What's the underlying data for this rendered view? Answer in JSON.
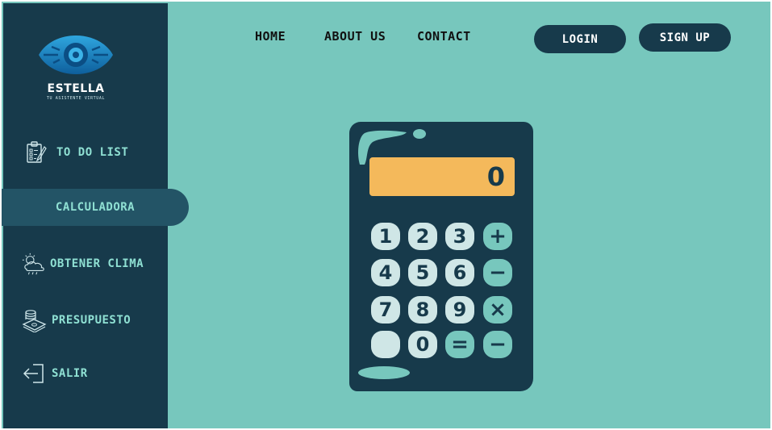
{
  "brand": {
    "name": "ESTELLA",
    "tagline": "TU ASISTENTE VIRTUAL"
  },
  "sidebar": {
    "items": [
      {
        "label": "TO DO LIST",
        "icon": "clipboard-checklist-icon"
      },
      {
        "label": "CALCULADORA",
        "icon": ""
      },
      {
        "label": "OBTENER CLIMA",
        "icon": "weather-cloud-icon"
      },
      {
        "label": "PRESUPUESTO",
        "icon": "money-stack-icon"
      },
      {
        "label": "SALIR",
        "icon": "logout-arrow-icon"
      }
    ],
    "active_index": 1
  },
  "topnav": {
    "links": [
      "HOME",
      "ABOUT US",
      "CONTACT"
    ],
    "login_label": "LOGIN",
    "signup_label": "SIGN UP"
  },
  "calculator": {
    "display_value": "0",
    "keys": [
      [
        "1",
        "2",
        "3",
        "+"
      ],
      [
        "4",
        "5",
        "6",
        "−"
      ],
      [
        "7",
        "8",
        "9",
        "×"
      ],
      [
        "",
        "0",
        "=",
        "−"
      ]
    ]
  },
  "colors": {
    "background": "#77c7bd",
    "sidebar": "#173a4b",
    "active_item": "#235466",
    "accent_text": "#8fe0d3",
    "display": "#f4b95b",
    "key_light": "#cfe6e6"
  }
}
